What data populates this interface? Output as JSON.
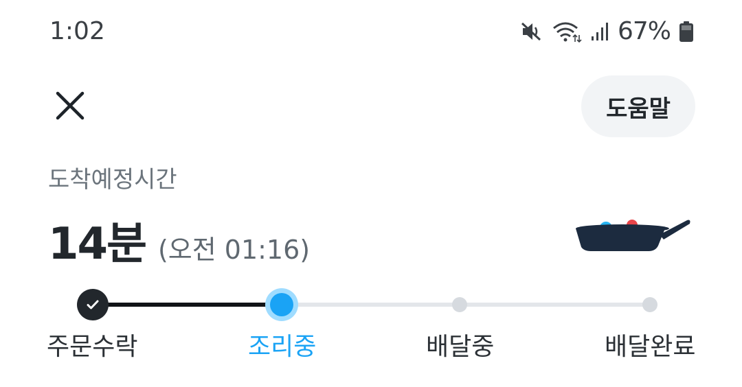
{
  "status_bar": {
    "time": "1:02",
    "battery": "67%",
    "icons": [
      "mute-icon",
      "wifi-icon",
      "signal-icon",
      "battery-icon"
    ]
  },
  "header": {
    "close_icon": "close-icon",
    "help_label": "도움말"
  },
  "eta": {
    "label": "도착예정시간",
    "minutes": "14분",
    "clock": "(오전 01:16)"
  },
  "illustration": "frying-pan-icon",
  "progress": {
    "steps": [
      {
        "label": "주문수락",
        "state": "done"
      },
      {
        "label": "조리중",
        "state": "current"
      },
      {
        "label": "배달중",
        "state": "pending"
      },
      {
        "label": "배달완료",
        "state": "pending"
      }
    ]
  },
  "colors": {
    "accent": "#1aa3f5",
    "accent_halo": "#9fdcff",
    "dark": "#22272c",
    "track": "#e3e6ea",
    "muted_text": "#6b747c"
  }
}
